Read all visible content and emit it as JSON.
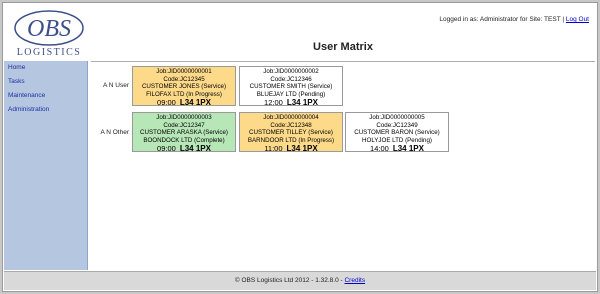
{
  "logo": {
    "top": "OBS",
    "bottom": "LOGISTICS"
  },
  "header": {
    "login_text": "Logged in as: Administrator for Site: TEST |",
    "logout_label": "Log Out",
    "title": "User Matrix"
  },
  "sidebar": {
    "items": [
      {
        "label": "Home"
      },
      {
        "label": "Tasks"
      },
      {
        "label": "Maintenance"
      },
      {
        "label": "Administration"
      }
    ]
  },
  "matrix": {
    "rows": [
      {
        "label": "A N User",
        "jobs": [
          {
            "job": "Job:JID0000000001",
            "code": "Code:JC12345",
            "customer": "CUSTOMER JONES (Service)",
            "company": "FILOFAX LTD (In Progress)",
            "time": "09:00",
            "postcode": "L34 1PX",
            "status": "service"
          },
          {
            "job": "Job:JID0000000002",
            "code": "Code:JC12346",
            "customer": "CUSTOMER SMITH (Service)",
            "company": "BLUEJAY LTD (Pending)",
            "time": "12:00",
            "postcode": "L34 1PX",
            "status": "pending"
          }
        ]
      },
      {
        "label": "A N Other",
        "jobs": [
          {
            "job": "Job:JID0000000003",
            "code": "Code:JC12347",
            "customer": "CUSTOMER ARASKA (Service)",
            "company": "BOONDOCK LTD (Complete)",
            "time": "09:00",
            "postcode": "L34 1PX",
            "status": "complete"
          },
          {
            "job": "Job:JID0000000004",
            "code": "Code:JC12348",
            "customer": "CUSTOMER TILLEY (Service)",
            "company": "BARNDOOR LTD (In Progress)",
            "time": "11:00",
            "postcode": "L34 1PX",
            "status": "service"
          },
          {
            "job": "Job:JID0000000005",
            "code": "Code:JC12349",
            "customer": "CUSTOMER BARON (Service)",
            "company": "HOLYJOE LTD (Pending)",
            "time": "14:00",
            "postcode": "L34 1PX",
            "status": "pending"
          }
        ]
      }
    ]
  },
  "footer": {
    "text": "© OBS Logistics Ltd 2012 - 1.32.8.0 -",
    "credits_label": "Credits"
  },
  "colors": {
    "in_progress": "#fdd98a",
    "pending": "#ffffff",
    "complete": "#b7e6b7",
    "sidebar": "#b5c6e0",
    "link": "#0000cc"
  }
}
